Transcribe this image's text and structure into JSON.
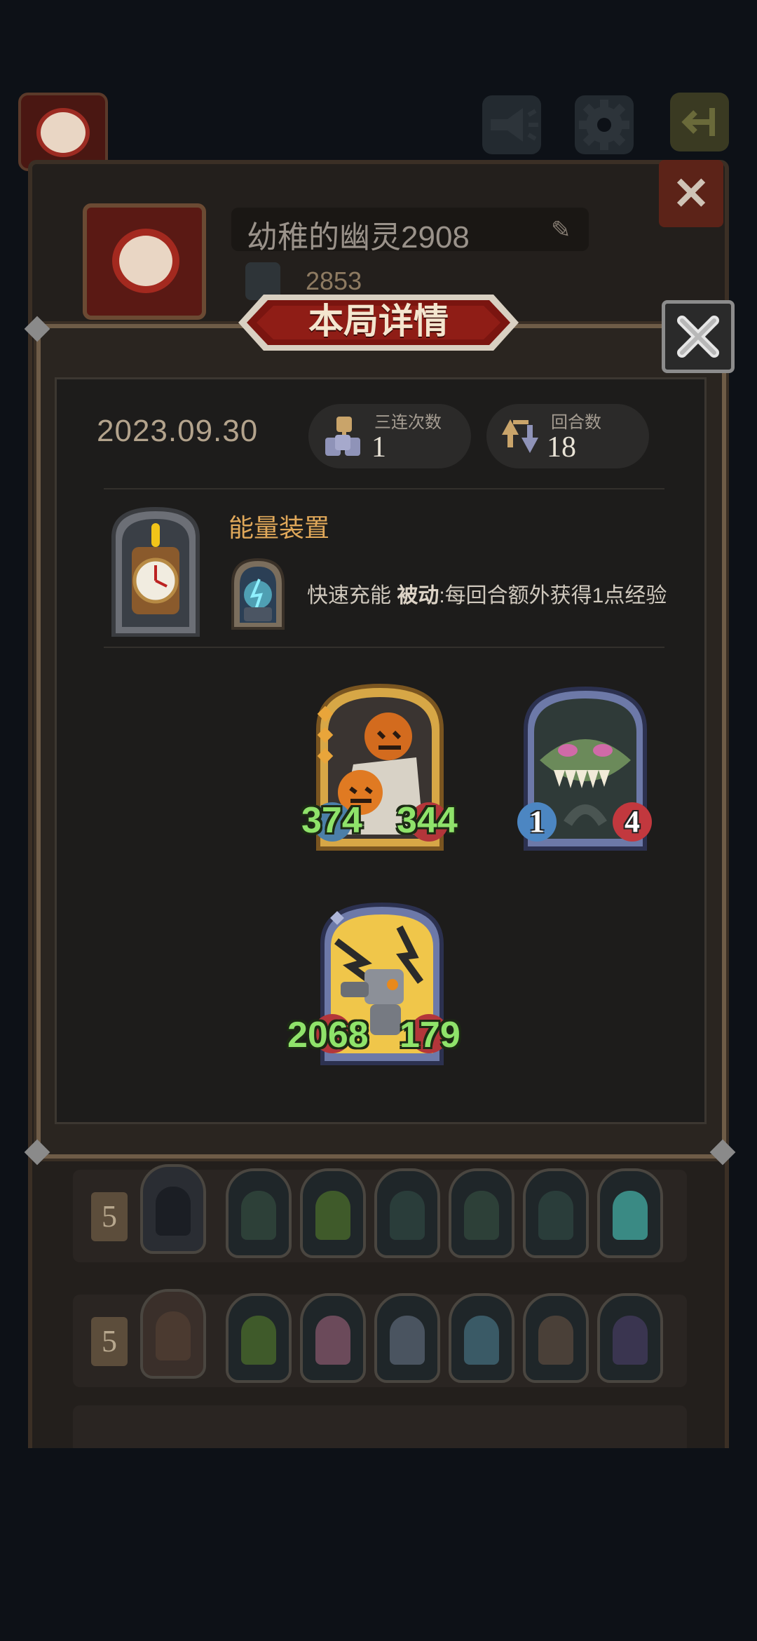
{
  "profile": {
    "name": "幼稚的幽灵2908",
    "score": "2853"
  },
  "modal": {
    "title": "本局详情",
    "date": "2023.09.30",
    "triples": {
      "label": "三连次数",
      "value": "1"
    },
    "rounds": {
      "label": "回合数",
      "value": "18"
    },
    "device_title": "能量装置",
    "skill": {
      "name": "快速充能",
      "type": "被动",
      "desc": ":每回合额外获得1点经验"
    },
    "cards": [
      {
        "name": "pumpkin-card",
        "attack": "374",
        "health": "344"
      },
      {
        "name": "sea-monster-card",
        "attack": "1",
        "health": "4"
      },
      {
        "name": "robot-card",
        "attack": "2068",
        "health": "179"
      }
    ]
  },
  "lineups": [
    {
      "level": "5"
    },
    {
      "level": "5"
    }
  ],
  "colors": {
    "gold": "#e0a85a",
    "stat_green": "#8fe36a",
    "banner_red": "#7a1510"
  }
}
